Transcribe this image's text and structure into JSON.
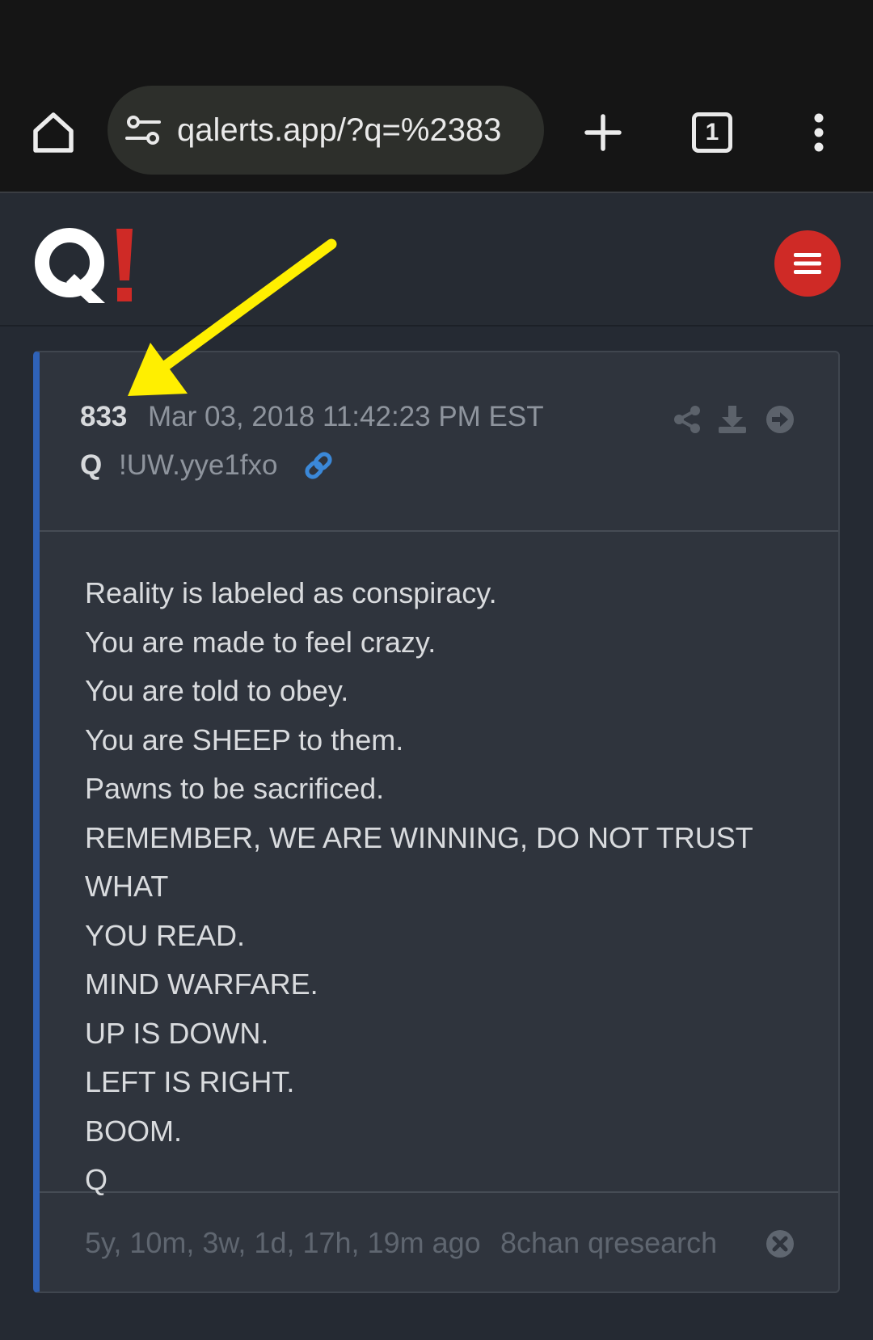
{
  "browser": {
    "url": "qalerts.app/?q=%2383",
    "tab_count": "1",
    "icons": {
      "home": "home-icon",
      "site_settings": "tune-icon",
      "new_tab": "plus-icon",
      "tabs": "tab-switcher-icon",
      "menu": "more-vert-icon"
    }
  },
  "site": {
    "logo_text": "Q!",
    "menu_icon": "hamburger-menu-icon",
    "accent_color": "#cf2a26",
    "card_accent_color": "#2f62b8"
  },
  "post": {
    "number": "833",
    "date": "Mar 03, 2018 11:42:23 PM EST",
    "author": "Q",
    "tripcode": "!UW.yye1fxo",
    "actions": [
      "share-icon",
      "download-icon",
      "arrow-right-circle-icon"
    ],
    "lines": [
      "Reality is labeled as conspiracy.",
      "You are made to feel crazy.",
      "You are told to obey.",
      "You are SHEEP to them.",
      "Pawns to be sacrificed.",
      "REMEMBER, WE ARE WINNING, DO NOT TRUST WHAT",
      "YOU READ.",
      "MIND WARFARE.",
      "UP IS DOWN.",
      "LEFT IS RIGHT.",
      "BOOM.",
      "Q"
    ],
    "age": "5y, 10m, 3w, 1d, 17h, 19m ago",
    "source": "8chan qresearch"
  },
  "annotation": {
    "arrow_color": "#ffef00"
  }
}
